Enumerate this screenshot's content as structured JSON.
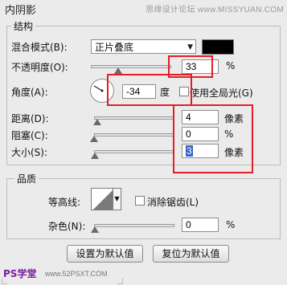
{
  "panel": {
    "title": "内阴影",
    "watermark_top": "思缘设计论坛 www.MISSYUAN.COM"
  },
  "structure": {
    "legend": "结构",
    "blend_mode_label": "混合模式(B):",
    "blend_mode_value": "正片叠底",
    "blend_color": "#000000",
    "opacity_label": "不透明度(O):",
    "opacity_value": "33",
    "opacity_unit": "%",
    "opacity_level": 0.33,
    "angle_label": "角度(A):",
    "angle_value": "-34",
    "angle_unit": "度",
    "global_light_label": "使用全局光(G)",
    "global_light_checked": false,
    "distance_label": "距离(D):",
    "distance_value": "4",
    "distance_unit": "像素",
    "choke_label": "阻塞(C):",
    "choke_value": "0",
    "choke_unit": "%",
    "size_label": "大小(S):",
    "size_value": "3",
    "size_unit": "像素"
  },
  "quality": {
    "legend": "品质",
    "contour_label": "等高线:",
    "antialias_label": "消除锯齿(L)",
    "antialias_checked": false,
    "noise_label": "杂色(N):",
    "noise_value": "0",
    "noise_unit": "%"
  },
  "buttons": {
    "make_default": "设置为默认值",
    "reset_default": "复位为默认值"
  },
  "footer": {
    "logo_text": "PS学堂",
    "watermark_bottom": "www.52PSXT.COM"
  },
  "annotation_color": "#e41e26"
}
